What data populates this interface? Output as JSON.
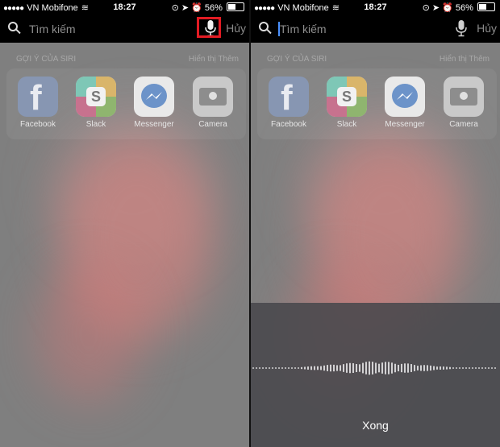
{
  "status_bar": {
    "carrier": "VN Mobifone",
    "time": "18:27",
    "battery": "56%",
    "battery_level": 0.56
  },
  "search": {
    "placeholder": "Tìm kiếm",
    "cancel_label": "Hủy"
  },
  "siri": {
    "header": "GỢI Ý CỦA SIRI",
    "show_more": "Hiển thị Thêm",
    "apps": [
      {
        "label": "Facebook",
        "icon": "facebook-app-icon"
      },
      {
        "label": "Slack",
        "icon": "slack-app-icon"
      },
      {
        "label": "Messenger",
        "icon": "messenger-app-icon"
      },
      {
        "label": "Camera",
        "icon": "camera-app-icon"
      }
    ]
  },
  "dictation": {
    "done_label": "Xong"
  },
  "colors": {
    "highlight": "#e31b23",
    "cursor": "#4a90ff"
  }
}
